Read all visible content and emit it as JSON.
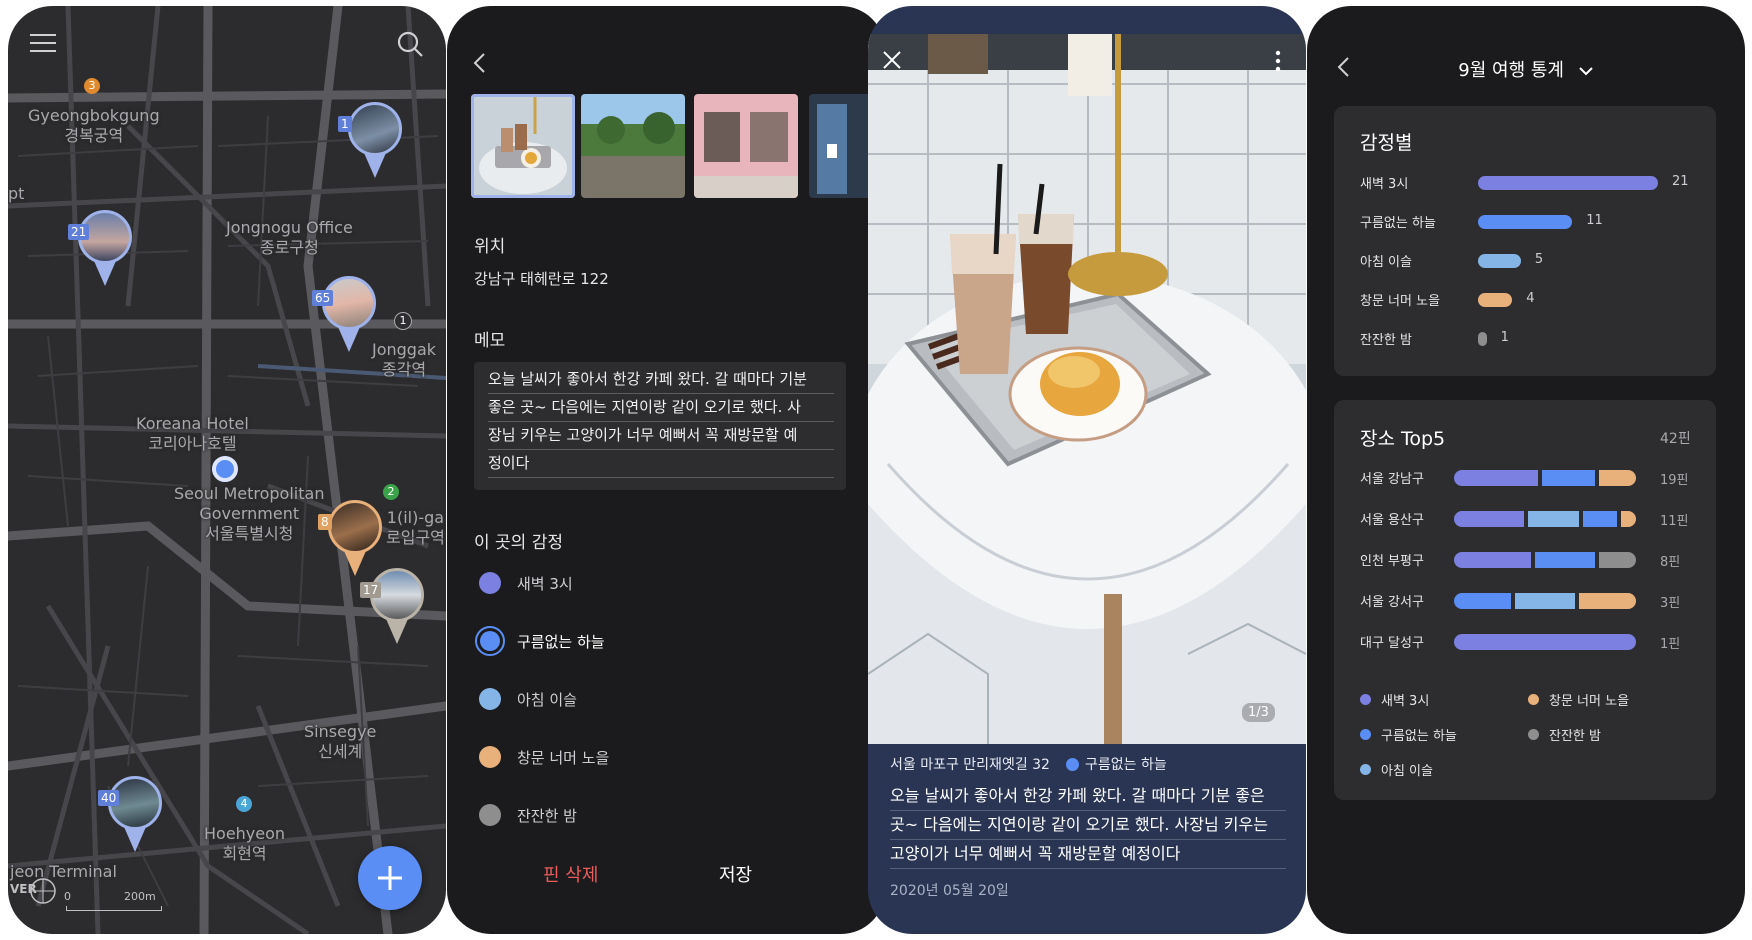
{
  "colors": {
    "dawn": "#7c80e0",
    "clear_sky": "#5a8ef5",
    "morning_dew": "#85b5e6",
    "sunset": "#e8b07a",
    "calm_night": "#8e8e8e",
    "delete_red": "#e95c5c"
  },
  "map_screen": {
    "menu_icon": "hamburger-menu-icon",
    "search_icon": "search-icon",
    "labels": {
      "gyeongbokgung": "Gyeongbokgung",
      "gyeongbokgung_kr": "경복궁역",
      "jongnogu_office": "Jongnogu Office",
      "jongnogu_office_kr": "종로구청",
      "jonggak": "Jonggak",
      "jonggak_kr": "종각역",
      "koreana": "Koreana Hotel",
      "koreana_kr": "코리아나호텔",
      "seoul_gov": "Seoul Metropolitan",
      "seoul_gov2": "Government",
      "seoul_gov_kr": "서울특별시청",
      "euljiro": "1(il)-ga",
      "euljiro_kr": "로입구역",
      "sinsegye": "Sinsegye",
      "sinsegye_kr": "신세계",
      "hoehyeon": "Hoehyeon",
      "hoehyeon_kr": "회현역",
      "terminal": "jeon Terminal",
      "scale": "200m",
      "scale_zero": "0",
      "pt": "pt",
      "naver": "VER"
    },
    "pins": [
      {
        "count": "1"
      },
      {
        "count": "21"
      },
      {
        "count": "65"
      },
      {
        "count": "8"
      },
      {
        "count": "17"
      },
      {
        "count": "40"
      }
    ],
    "line_badges": [
      "3",
      "1",
      "2",
      "4"
    ],
    "fab_icon": "plus-icon"
  },
  "detail_screen": {
    "back_icon": "chevron-left-icon",
    "location_title": "위치",
    "location_value": "강남구 태헤란로 122",
    "memo_title": "메모",
    "memo_lines": [
      "오늘 날씨가 좋아서 한강 카페 왔다. 갈 때마다 기분",
      "좋은 곳~ 다음에는 지연이랑 같이 오기로 했다. 사",
      "장님 키우는 고양이가 너무 예뻐서 꼭 재방문할 예",
      "정이다"
    ],
    "emotion_title": "이 곳의 감정",
    "emotions": [
      {
        "label": "새벽 3시",
        "color": "#7c80e0"
      },
      {
        "label": "구름없는 하늘",
        "color": "#5a8ef5"
      },
      {
        "label": "아침 이슬",
        "color": "#85b5e6"
      },
      {
        "label": "창문 너머 노을",
        "color": "#e8b07a"
      },
      {
        "label": "잔잔한 밤",
        "color": "#8e8e8e"
      }
    ],
    "selected_emotion": "구름없는 하늘",
    "delete_label": "핀 삭제",
    "save_label": "저장"
  },
  "photo_screen": {
    "close_icon": "close-icon",
    "more_icon": "more-vertical-icon",
    "counter": "1/3",
    "address": "서울 마포구 만리재옛길 32",
    "emotion": "구름없는 하늘",
    "memo_lines": [
      "오늘 날씨가 좋아서 한강 카페 왔다. 갈 때마다 기분 좋은",
      "곳~ 다음에는 지연이랑 같이 오기로 했다. 사장님 키우는",
      "고양이가 너무 예뻐서 꼭 재방문할 예정이다"
    ],
    "date": "2020년 05월 20일"
  },
  "stats_screen": {
    "back_icon": "chevron-left-icon",
    "title": "9월 여행 통계",
    "dropdown_icon": "chevron-down-icon",
    "emotion_card": {
      "title": "감정별",
      "items": [
        {
          "label": "새벽 3시",
          "value": "21",
          "count": 21,
          "color": "#7c80e0"
        },
        {
          "label": "구름없는 하늘",
          "value": "11",
          "count": 11,
          "color": "#5a8ef5"
        },
        {
          "label": "아침 이슬",
          "value": "5",
          "count": 5,
          "color": "#85b5e6"
        },
        {
          "label": "창문 너머 노을",
          "value": "4",
          "count": 4,
          "color": "#e8b07a"
        },
        {
          "label": "잔잔한 밤",
          "value": "1",
          "count": 1,
          "color": "#8e8e8e"
        }
      ]
    },
    "place_card": {
      "title": "장소 Top5",
      "total": "42핀",
      "items": [
        {
          "label": "서울 강남구",
          "pins": "19핀",
          "segments": [
            {
              "emotion": "dawn",
              "share": 0.48
            },
            {
              "emotion": "clear_sky",
              "share": 0.31
            },
            {
              "emotion": "sunset",
              "share": 0.21
            }
          ]
        },
        {
          "label": "서울 용산구",
          "pins": "11핀",
          "segments": [
            {
              "emotion": "dawn",
              "share": 0.41
            },
            {
              "emotion": "morning_dew",
              "share": 0.3
            },
            {
              "emotion": "clear_sky",
              "share": 0.2
            },
            {
              "emotion": "sunset",
              "share": 0.09
            }
          ]
        },
        {
          "label": "인천 부평구",
          "pins": "8핀",
          "segments": [
            {
              "emotion": "dawn",
              "share": 0.44
            },
            {
              "emotion": "clear_sky",
              "share": 0.35
            },
            {
              "emotion": "calm_night",
              "share": 0.21
            }
          ]
        },
        {
          "label": "서울 강서구",
          "pins": "3핀",
          "segments": [
            {
              "emotion": "clear_sky",
              "share": 0.33
            },
            {
              "emotion": "morning_dew",
              "share": 0.34
            },
            {
              "emotion": "sunset",
              "share": 0.33
            }
          ]
        },
        {
          "label": "대구 달성구",
          "pins": "1핀",
          "segments": [
            {
              "emotion": "dawn",
              "share": 1.0
            }
          ]
        }
      ],
      "legend": [
        {
          "label": "새벽 3시",
          "color": "#7c80e0"
        },
        {
          "label": "창문 너머 노을",
          "color": "#e8b07a"
        },
        {
          "label": "구름없는 하늘",
          "color": "#5a8ef5"
        },
        {
          "label": "잔잔한 밤",
          "color": "#8e8e8e"
        },
        {
          "label": "아침 이슬",
          "color": "#85b5e6"
        }
      ]
    }
  }
}
